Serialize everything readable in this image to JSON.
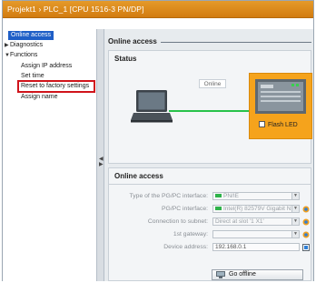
{
  "window": {
    "title": "Projekt1  ›  PLC_1 [CPU 1516-3 PN/DP]"
  },
  "nav": {
    "items": [
      {
        "label": "Online access",
        "arrow": ""
      },
      {
        "label": "Diagnostics",
        "arrow": "▶"
      },
      {
        "label": "Functions",
        "arrow": "▼"
      },
      {
        "label": "Assign IP address",
        "arrow": ""
      },
      {
        "label": "Set time",
        "arrow": ""
      },
      {
        "label": "Reset to factory settings",
        "arrow": ""
      },
      {
        "label": "Assign name",
        "arrow": ""
      }
    ]
  },
  "content": {
    "header": "Online access",
    "status": {
      "title": "Status",
      "connection_label": "Online",
      "flash_led_label": "Flash LED",
      "colors": {
        "connection": "#27c24a",
        "plc_highlight": "#f5a31c"
      }
    },
    "online_access": {
      "title": "Online access",
      "fields": [
        {
          "label": "Type of the PG/PC interface:",
          "value": "PN/IE",
          "icon": "network-icon"
        },
        {
          "label": "PG/PC interface:",
          "value": "Intel(R) 82579V Gigabit N...",
          "icon": "nic-icon"
        },
        {
          "label": "Connection to subnet:",
          "value": "Direct at slot '1 X1'",
          "icon": ""
        },
        {
          "label": "1st gateway:",
          "value": "",
          "icon": ""
        },
        {
          "label": "Device address:",
          "value": "192.168.0.1",
          "icon": ""
        }
      ],
      "go_offline_label": "Go offline"
    }
  }
}
